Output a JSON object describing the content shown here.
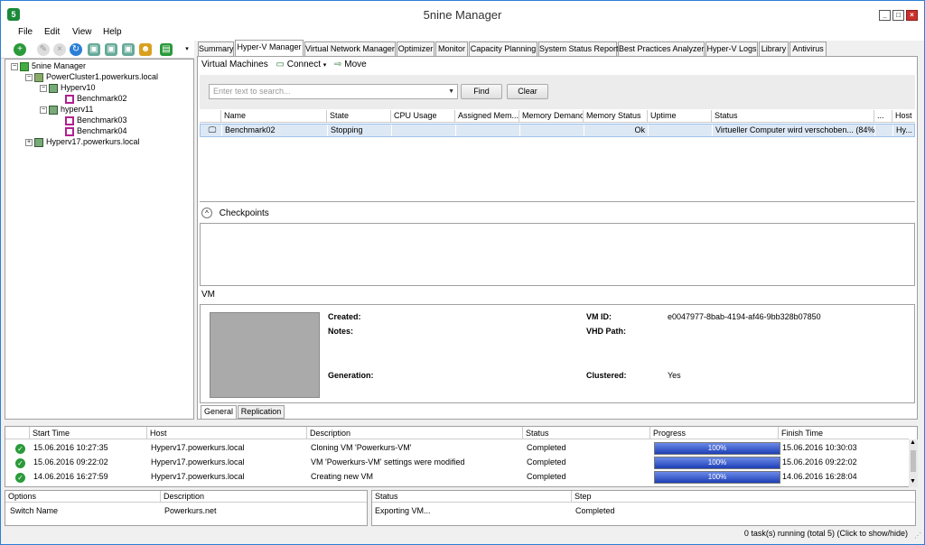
{
  "window": {
    "title": "5nine Manager",
    "app_icon": "5"
  },
  "menu": [
    "File",
    "Edit",
    "View",
    "Help"
  ],
  "tree": [
    {
      "label": "5nine Manager",
      "icon": "manager-icon"
    },
    {
      "label": "PowerCluster1.powerkurs.local",
      "icon": "cluster-icon"
    },
    {
      "label": "Hyperv10",
      "icon": "host-icon"
    },
    {
      "label": "Benchmark02",
      "icon": "vm-icon"
    },
    {
      "label": "hyperv11",
      "icon": "host-icon"
    },
    {
      "label": "Benchmark03",
      "icon": "vm-icon"
    },
    {
      "label": "Benchmark04",
      "icon": "vm-icon"
    },
    {
      "label": "Hyperv17.powerkurs.local",
      "icon": "host-icon"
    }
  ],
  "tabs": [
    "Summary",
    "Hyper-V Manager",
    "Virtual Network Manager",
    "Optimizer",
    "Monitor",
    "Capacity Planning",
    "System Status Report",
    "Best Practices Analyzer",
    "Hyper-V Logs",
    "Library",
    "Antivirus"
  ],
  "vm_toolbar": {
    "title": "Virtual Machines",
    "connect": "Connect",
    "move": "Move"
  },
  "search": {
    "placeholder": "Enter text to search...",
    "find": "Find",
    "clear": "Clear"
  },
  "vm_columns": [
    "Name",
    "State",
    "CPU Usage",
    "Assigned Mem...",
    "Memory Demand",
    "Memory Status",
    "Uptime",
    "Status",
    "...",
    "Host"
  ],
  "vm_rows": [
    {
      "name": "Benchmark02",
      "state": "Stopping",
      "cpu": "",
      "assigned": "",
      "demand": "",
      "mem_status": "Ok",
      "uptime": "",
      "status": "Virtueller Computer wird verschoben... (84%)",
      "dots": "",
      "host": "Hy..."
    }
  ],
  "checkpoints": {
    "title": "Checkpoints",
    "toggle": "^"
  },
  "vm_section": {
    "title": "VM"
  },
  "vm_details": {
    "created_label": "Created:",
    "created_value": "",
    "notes_label": "Notes:",
    "notes_value": "",
    "generation_label": "Generation:",
    "generation_value": "",
    "vmid_label": "VM ID:",
    "vmid_value": "e0047977-8bab-4194-af46-9bb328b07850",
    "vhd_label": "VHD Path:",
    "vhd_value": "",
    "clustered_label": "Clustered:",
    "clustered_value": "Yes"
  },
  "detail_tabs": [
    "General",
    "Replication"
  ],
  "task_columns": [
    "Start Time",
    "Host",
    "Description",
    "Status",
    "Progress",
    "Finish Time"
  ],
  "tasks": [
    {
      "start": "15.06.2016 10:27:35",
      "host": "Hyperv17.powerkurs.local",
      "description": "Cloning VM 'Powerkurs-VM'",
      "status": "Completed",
      "progress": 100,
      "progress_text": "100%",
      "finish": "15.06.2016 10:30:03"
    },
    {
      "start": "15.06.2016 09:22:02",
      "host": "Hyperv17.powerkurs.local",
      "description": "VM 'Powerkurs-VM' settings were modified",
      "status": "Completed",
      "progress": 100,
      "progress_text": "100%",
      "finish": "15.06.2016 09:22:02"
    },
    {
      "start": "14.06.2016 16:27:59",
      "host": "Hyperv17.powerkurs.local",
      "description": "Creating new VM",
      "status": "Completed",
      "progress": 100,
      "progress_text": "100%",
      "finish": "14.06.2016 16:28:04"
    }
  ],
  "options": {
    "columns": [
      "Options",
      "Description"
    ],
    "rows": [
      {
        "option": "Switch Name",
        "description": "Powerkurs.net"
      }
    ]
  },
  "steps": {
    "columns": [
      "Status",
      "Step"
    ],
    "rows": [
      {
        "status": "Exporting VM...",
        "step": "Completed"
      }
    ]
  },
  "statusbar": {
    "text": "0 task(s) running (total 5) (Click to show/hide)"
  },
  "colors": {
    "accent": "#2b7fd6",
    "progress": "#1d3fb5",
    "selection": "#dde8f5",
    "success": "#2a9a3a",
    "vm_icon": "#b02090"
  }
}
